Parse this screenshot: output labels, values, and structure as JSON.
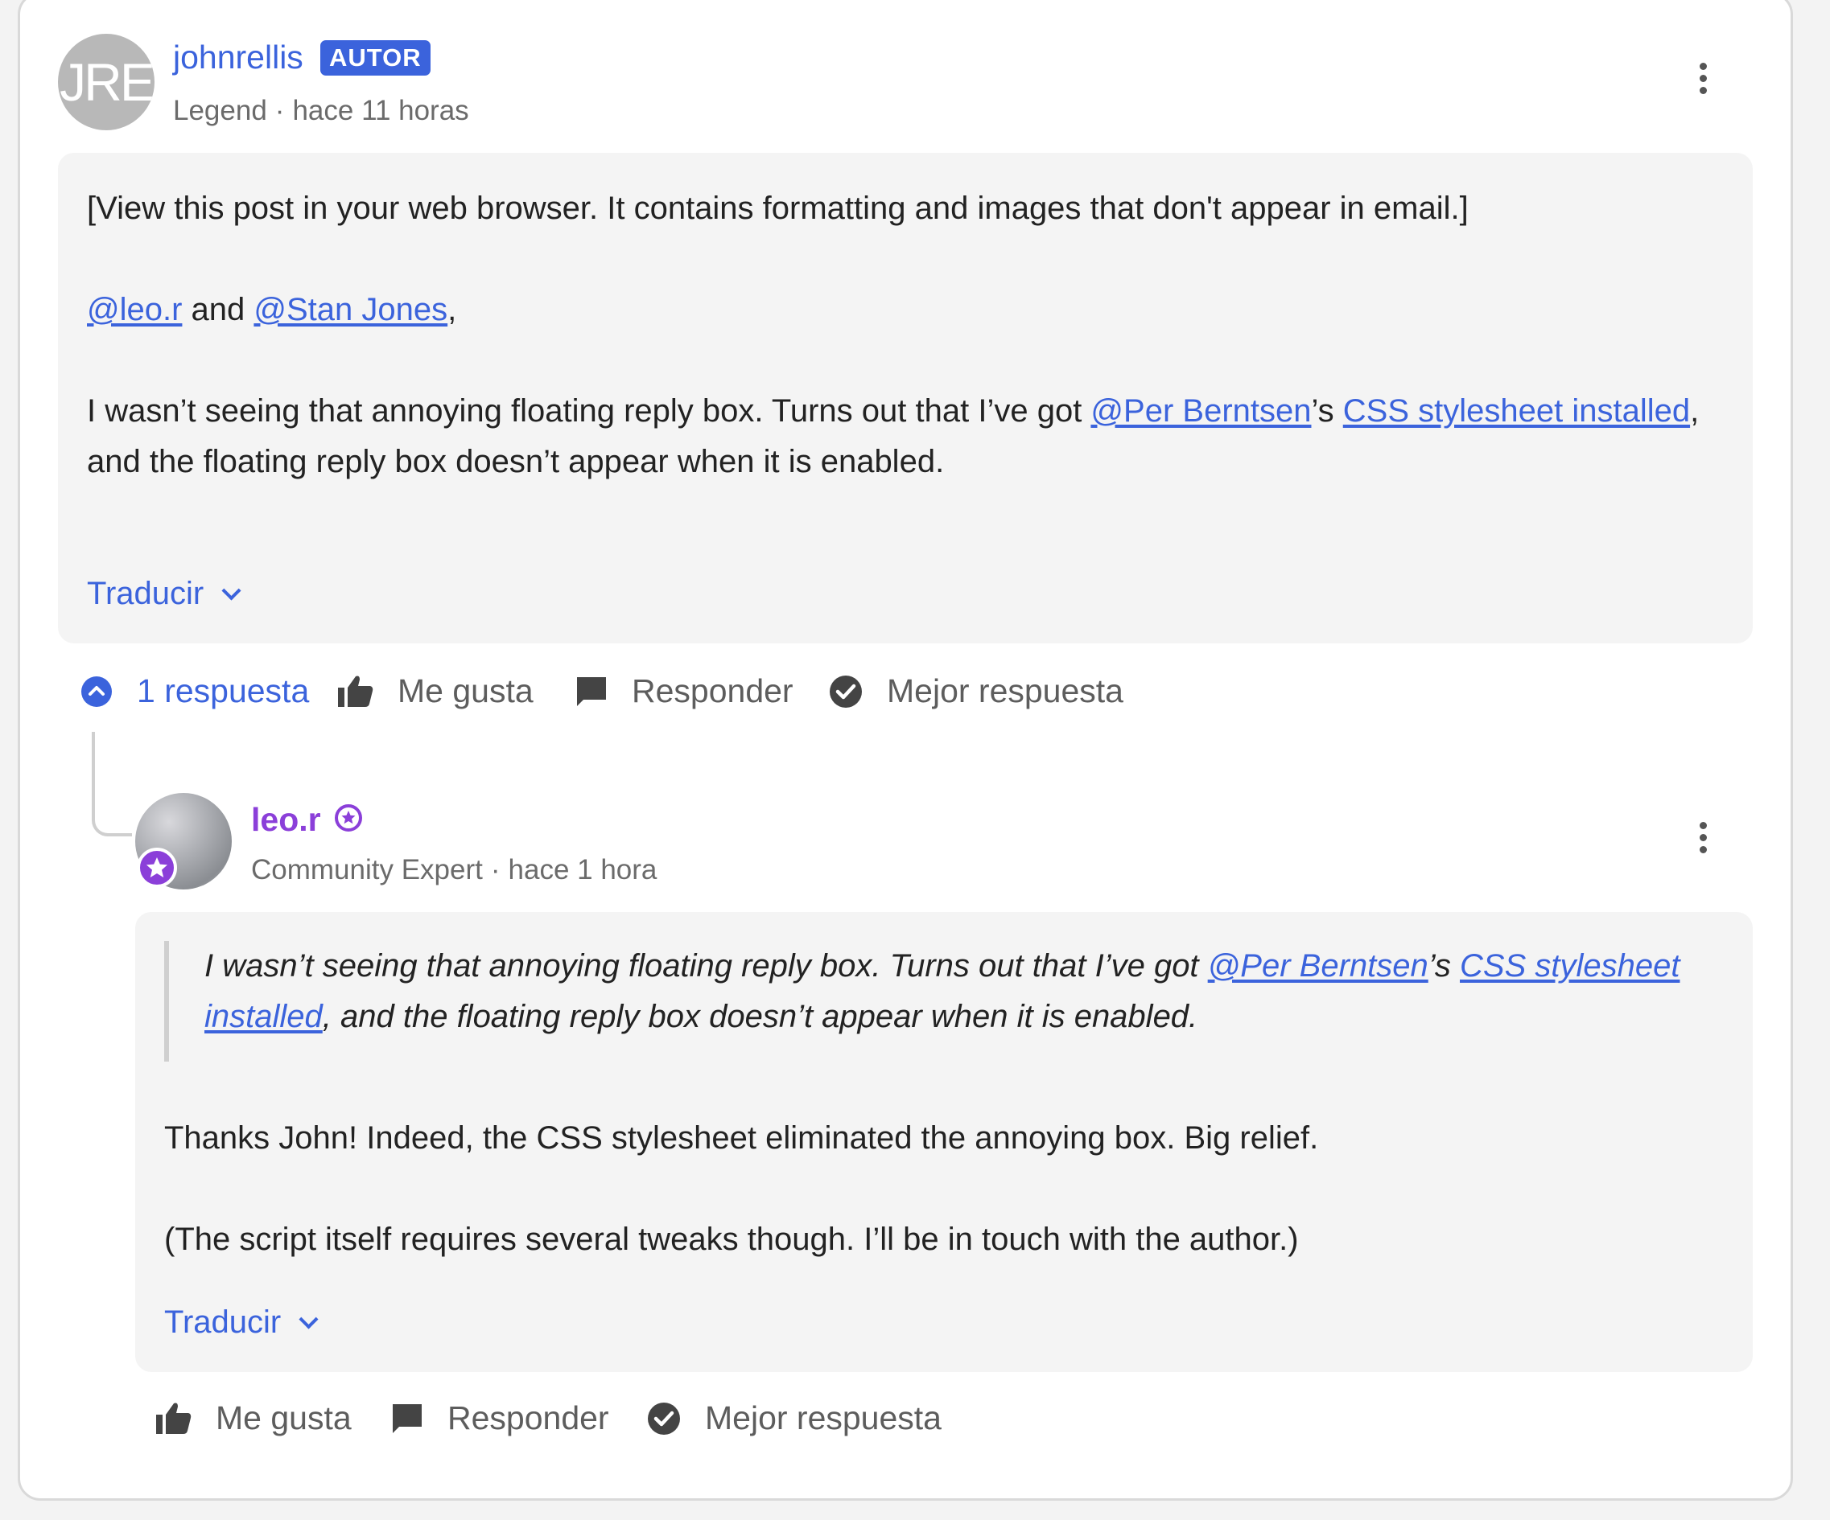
{
  "post": {
    "avatar_initials": "JRE",
    "username": "johnrellis",
    "badge": "AUTOR",
    "rank": "Legend",
    "separator": "·",
    "time": "hace 11 horas",
    "line1": "[View this post in your web browser. It contains formatting and images that don't appear in email.]",
    "mention1": "@leo.r",
    "and": " and ",
    "mention2": "@Stan Jones",
    "comma": ",",
    "p3_start": "I wasn’t seeing that annoying floating reply box. Turns out that I’ve got ",
    "p3_mention": "@Per Berntsen",
    "p3_poss": "’s ",
    "p3_link": "CSS stylesheet installed",
    "p3_end": ", and the floating reply box doesn’t appear when it is enabled.",
    "translate": "Traducir"
  },
  "actions": {
    "replies": "1 respuesta",
    "like": "Me gusta",
    "reply": "Responder",
    "best": "Mejor respuesta"
  },
  "reply": {
    "username": "leo.r",
    "rank": "Community Expert",
    "separator": "·",
    "time": "hace 1 hora",
    "quote_start": "I wasn’t seeing that annoying floating reply box. Turns out that I’ve got ",
    "quote_mention": "@Per Berntsen",
    "quote_poss": "’s ",
    "quote_link": "CSS stylesheet installed",
    "quote_end": ", and the floating reply box doesn’t appear when it is enabled.",
    "p1": "Thanks John! Indeed, the CSS stylesheet eliminated the annoying box. Big relief.",
    "p2": "(The script itself requires several tweaks though. I’ll be in touch with the author.)",
    "translate": "Traducir"
  },
  "reply_actions": {
    "like": "Me gusta",
    "reply": "Responder",
    "best": "Mejor respuesta"
  },
  "colors": {
    "accent": "#3b63dc",
    "expert": "#8b3fd9",
    "body_bg": "#f4f4f4"
  },
  "icons": [
    "kebab-menu-icon",
    "chevron-down-icon",
    "chevron-up-circle-icon",
    "thumbs-up-icon",
    "comment-icon",
    "check-circle-icon",
    "star-badge-icon"
  ]
}
